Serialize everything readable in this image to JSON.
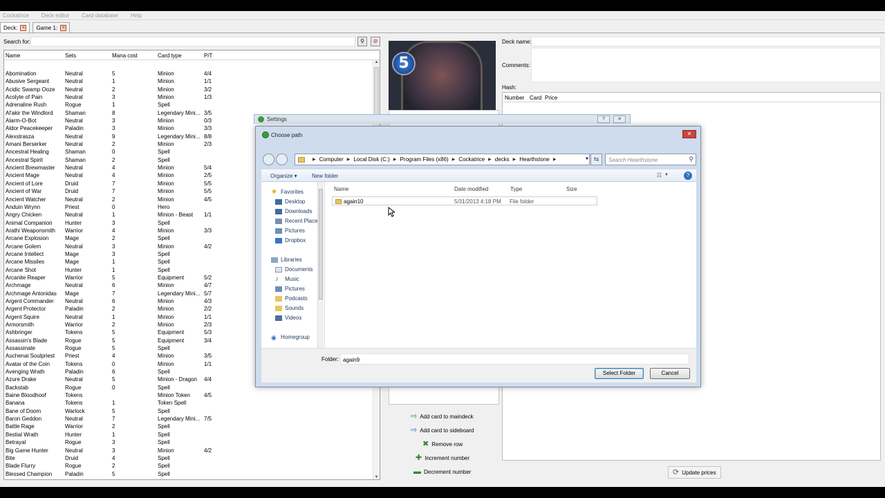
{
  "menubar": [
    "Cockatrice",
    "Deck editor",
    "Card database",
    "Help"
  ],
  "tabs": [
    {
      "label": "Deck:"
    },
    {
      "label": "Game 1:"
    }
  ],
  "search": {
    "label": "Search for:",
    "value": ""
  },
  "card_table": {
    "columns": [
      "Name",
      "Sets",
      "Mana cost",
      "Card type",
      "P/T"
    ],
    "rows": [
      [
        "Abomination",
        "Neutral",
        "5",
        "Minion",
        "4/4"
      ],
      [
        "Abusive Sergeant",
        "Neutral",
        "1",
        "Minion",
        "1/1"
      ],
      [
        "Acidic Swamp Ooze",
        "Neutral",
        "2",
        "Minion",
        "3/2"
      ],
      [
        "Acolyte of Pain",
        "Neutral",
        "3",
        "Minion",
        "1/3"
      ],
      [
        "Adrenaline Rush",
        "Rogue",
        "1",
        "Spell",
        ""
      ],
      [
        "Al'akir the Windlord",
        "Shaman",
        "8",
        "Legendary Mini...",
        "3/5"
      ],
      [
        "Alarm-O-Bot",
        "Neutral",
        "3",
        "Minion",
        "0/3"
      ],
      [
        "Aldor Peacekeeper",
        "Paladin",
        "3",
        "Minion",
        "3/3"
      ],
      [
        "Alexstrasza",
        "Neutral",
        "9",
        "Legendary Mini...",
        "8/8"
      ],
      [
        "Amani Berserker",
        "Neutral",
        "2",
        "Minion",
        "2/3"
      ],
      [
        "Ancestral Healing",
        "Shaman",
        "0",
        "Spell",
        ""
      ],
      [
        "Ancestral Spirit",
        "Shaman",
        "2",
        "Spell",
        ""
      ],
      [
        "Ancient Brewmaster",
        "Neutral",
        "4",
        "Minion",
        "5/4"
      ],
      [
        "Ancient Mage",
        "Neutral",
        "4",
        "Minion",
        "2/5"
      ],
      [
        "Ancient of Lore",
        "Druid",
        "7",
        "Minion",
        "5/5"
      ],
      [
        "Ancient of War",
        "Druid",
        "7",
        "Minion",
        "5/5"
      ],
      [
        "Ancient Watcher",
        "Neutral",
        "2",
        "Minion",
        "4/5"
      ],
      [
        "Anduin Wrynn",
        "Priest",
        "0",
        "Hero",
        ""
      ],
      [
        "Angry Chicken",
        "Neutral",
        "1",
        "Minion - Beast",
        "1/1"
      ],
      [
        "Animal Companion",
        "Hunter",
        "3",
        "Spell",
        ""
      ],
      [
        "Arathi Weaponsmith",
        "Warrior",
        "4",
        "Minion",
        "3/3"
      ],
      [
        "Arcane Explosion",
        "Mage",
        "2",
        "Spell",
        ""
      ],
      [
        "Arcane Golem",
        "Neutral",
        "3",
        "Minion",
        "4/2"
      ],
      [
        "Arcane Intellect",
        "Mage",
        "3",
        "Spell",
        ""
      ],
      [
        "Arcane Missiles",
        "Mage",
        "1",
        "Spell",
        ""
      ],
      [
        "Arcane Shot",
        "Hunter",
        "1",
        "Spell",
        ""
      ],
      [
        "Arcanite Reaper",
        "Warrior",
        "5",
        "Equipment",
        "5/2"
      ],
      [
        "Archmage",
        "Neutral",
        "6",
        "Minion",
        "4/7"
      ],
      [
        "Archmage Antonidas",
        "Mage",
        "7",
        "Legendary Mini...",
        "5/7"
      ],
      [
        "Argent Commander",
        "Neutral",
        "6",
        "Minion",
        "4/3"
      ],
      [
        "Argent Protector",
        "Paladin",
        "2",
        "Minion",
        "2/2"
      ],
      [
        "Argent Squire",
        "Neutral",
        "1",
        "Minion",
        "1/1"
      ],
      [
        "Armorsmith",
        "Warrior",
        "2",
        "Minion",
        "2/3"
      ],
      [
        "Ashbringer",
        "Tokens",
        "5",
        "Equipment",
        "5/3"
      ],
      [
        "Assassin's Blade",
        "Rogue",
        "5",
        "Equipment",
        "3/4"
      ],
      [
        "Assassinate",
        "Rogue",
        "5",
        "Spell",
        ""
      ],
      [
        "Auchenai Soulpriest",
        "Priest",
        "4",
        "Minion",
        "3/5"
      ],
      [
        "Avatar of the Coin",
        "Tokens",
        "0",
        "Minion",
        "1/1"
      ],
      [
        "Avenging Wrath",
        "Paladin",
        "6",
        "Spell",
        ""
      ],
      [
        "Azure Drake",
        "Neutral",
        "5",
        "Minion - Dragon",
        "4/4"
      ],
      [
        "Backstab",
        "Rogue",
        "0",
        "Spell",
        ""
      ],
      [
        "Baine Bloodhoof",
        "Tokens",
        "",
        "Minion Token",
        "4/5"
      ],
      [
        "Banana",
        "Tokens",
        "1",
        "Token Spell",
        ""
      ],
      [
        "Bane of Doom",
        "Warlock",
        "5",
        "Spell",
        ""
      ],
      [
        "Baron Geddon",
        "Neutral",
        "7",
        "Legendary Mini...",
        "7/5"
      ],
      [
        "Battle Rage",
        "Warrior",
        "2",
        "Spell",
        ""
      ],
      [
        "Bestial Wrath",
        "Hunter",
        "1",
        "Spell",
        ""
      ],
      [
        "Betrayal",
        "Rogue",
        "3",
        "Spell",
        ""
      ],
      [
        "Big Game Hunter",
        "Neutral",
        "3",
        "Minion",
        "4/2"
      ],
      [
        "Bite",
        "Druid",
        "4",
        "Spell",
        ""
      ],
      [
        "Blade Flurry",
        "Rogue",
        "2",
        "Spell",
        ""
      ],
      [
        "Blessed Champion",
        "Paladin",
        "5",
        "Spell",
        ""
      ]
    ]
  },
  "card_preview": {
    "mana": "5"
  },
  "deck": {
    "name_label": "Deck name:",
    "comments_label": "Comments:",
    "hash_label": "Hash:",
    "columns": [
      "Number",
      "Card",
      "Price"
    ]
  },
  "actions": {
    "add_main": "Add card to maindeck",
    "add_side": "Add card to sideboard",
    "remove_row": "Remove row",
    "increment": "Increment number",
    "decrement": "Decrement number",
    "update_prices": "Update prices"
  },
  "settings_window": {
    "title": "Settings",
    "help": "?",
    "close": "✕"
  },
  "dialog": {
    "title": "Choose path",
    "breadcrumb": [
      "Computer",
      "Local Disk (C:)",
      "Program Files (x86)",
      "Cockatrice",
      "decks",
      "Hearthstone"
    ],
    "search_placeholder": "Search Hearthstone",
    "toolbar": {
      "organize": "Organize ▾",
      "new_folder": "New folder"
    },
    "nav": {
      "favorites": "Favorites",
      "favorites_items": [
        "Desktop",
        "Downloads",
        "Recent Places",
        "Pictures",
        "Dropbox"
      ],
      "libraries": "Libraries",
      "libraries_items": [
        "Documents",
        "Music",
        "Pictures",
        "Podcasts",
        "Sounds",
        "Videos"
      ],
      "homegroup": "Homegroup"
    },
    "columns": [
      "Name",
      "Date modified",
      "Type",
      "Size"
    ],
    "files": [
      {
        "name": "again10",
        "date": "5/31/2013 4:18 PM",
        "type": "File folder",
        "size": ""
      }
    ],
    "folder_label": "Folder:",
    "folder_value": "again9",
    "select_button": "Select Folder",
    "cancel_button": "Cancel"
  },
  "colors": {
    "accent": "#3c7fb1",
    "folder": "#e9c560",
    "close_red": "#c9463d",
    "mana_blue": "#1c4a9c"
  }
}
